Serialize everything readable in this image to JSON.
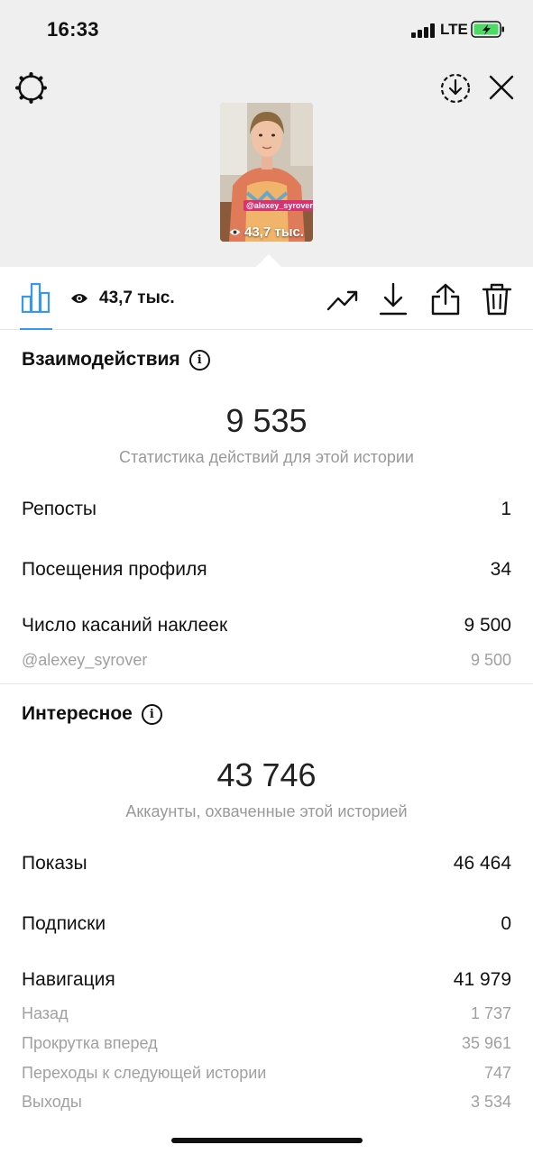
{
  "status_bar": {
    "time": "16:33",
    "network": "LTE"
  },
  "story": {
    "mention_tag": "@alexey_syrover",
    "thumb_views": "43,7 тыс."
  },
  "toolbar": {
    "views": "43,7 тыс."
  },
  "interactions": {
    "title": "Взаимодействия",
    "total": "9 535",
    "caption": "Статистика действий для этой истории",
    "rows": [
      {
        "label": "Репосты",
        "value": "1"
      },
      {
        "label": "Посещения профиля",
        "value": "34"
      },
      {
        "label": "Число касаний наклеек",
        "value": "9 500"
      }
    ],
    "sub_rows": [
      {
        "label": "@alexey_syrover",
        "value": "9 500"
      }
    ]
  },
  "discovery": {
    "title": "Интересное",
    "total": "43 746",
    "caption": "Аккаунты, охваченные этой историей",
    "rows": [
      {
        "label": "Показы",
        "value": "46 464"
      },
      {
        "label": "Подписки",
        "value": "0"
      },
      {
        "label": "Навигация",
        "value": "41 979"
      }
    ],
    "sub_rows": [
      {
        "label": "Назад",
        "value": "1 737"
      },
      {
        "label": "Прокрутка вперед",
        "value": "35 961"
      },
      {
        "label": "Переходы к следующей истории",
        "value": "747"
      },
      {
        "label": "Выходы",
        "value": "3 534"
      }
    ]
  },
  "colors": {
    "accent": "#3897f0",
    "tag": "#d8326f",
    "battery": "#4cd964"
  }
}
